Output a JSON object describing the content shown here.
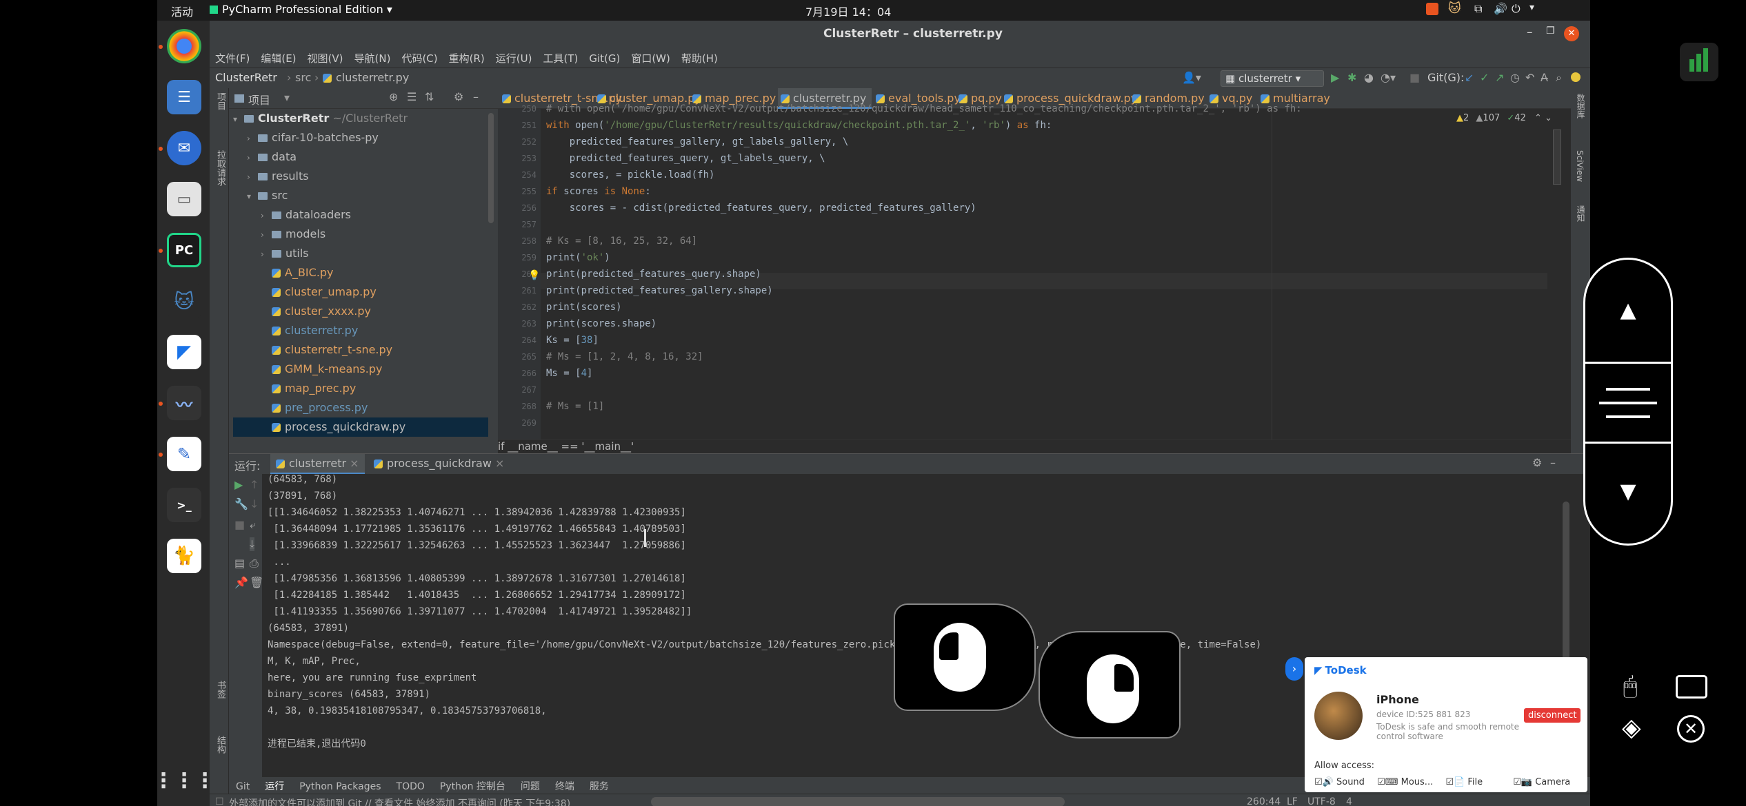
{
  "topbar": {
    "activities": "活动",
    "app": "PyCharm Professional Edition",
    "clock": "7月19日 14：04"
  },
  "title": "ClusterRetr – clusterretr.py",
  "menu": [
    "文件(F)",
    "编辑(E)",
    "视图(V)",
    "导航(N)",
    "代码(C)",
    "重构(R)",
    "运行(U)",
    "工具(T)",
    "Git(G)",
    "窗口(W)",
    "帮助(H)"
  ],
  "nav": {
    "project": "ClusterRetr",
    "folder": "src",
    "file": "clusterretr.py",
    "run_config": "clusterretr",
    "git_label": "Git(G):"
  },
  "project": {
    "header": "项目",
    "root": "ClusterRetr",
    "root_path": "~/ClusterRetr",
    "items": [
      {
        "label": "cifar-10-batches-py",
        "kind": "folder",
        "depth": 1
      },
      {
        "label": "data",
        "kind": "folder",
        "depth": 1
      },
      {
        "label": "results",
        "kind": "folder",
        "depth": 1
      },
      {
        "label": "src",
        "kind": "folder",
        "depth": 1,
        "open": true
      },
      {
        "label": "dataloaders",
        "kind": "folder",
        "depth": 2
      },
      {
        "label": "models",
        "kind": "folder",
        "depth": 2
      },
      {
        "label": "utils",
        "kind": "folder",
        "depth": 2
      },
      {
        "label": "A_BIC.py",
        "kind": "file",
        "depth": 2,
        "color": "#e0a060"
      },
      {
        "label": "cluster_umap.py",
        "kind": "file",
        "depth": 2,
        "color": "#e0a060"
      },
      {
        "label": "cluster_xxxx.py",
        "kind": "file",
        "depth": 2,
        "color": "#e0a060"
      },
      {
        "label": "clusterretr.py",
        "kind": "file",
        "depth": 2,
        "color": "#6897bb"
      },
      {
        "label": "clusterretr_t-sne.py",
        "kind": "file",
        "depth": 2,
        "color": "#e0a060"
      },
      {
        "label": "GMM_k-means.py",
        "kind": "file",
        "depth": 2,
        "color": "#e0a060"
      },
      {
        "label": "map_prec.py",
        "kind": "file",
        "depth": 2,
        "color": "#e0a060"
      },
      {
        "label": "pre_process.py",
        "kind": "file",
        "depth": 2,
        "color": "#6897bb"
      },
      {
        "label": "process_quickdraw.py",
        "kind": "file",
        "depth": 2,
        "color": "#bbbbbb",
        "selected": true
      }
    ]
  },
  "tabs": [
    {
      "label": "clusterretr_t-sne.py"
    },
    {
      "label": "cluster_umap.py"
    },
    {
      "label": "map_prec.py"
    },
    {
      "label": "clusterretr.py",
      "active": true
    },
    {
      "label": "eval_tools.py"
    },
    {
      "label": "pq.py"
    },
    {
      "label": "process_quickdraw.py"
    },
    {
      "label": "random.py"
    },
    {
      "label": "vq.py"
    },
    {
      "label": "multiarray"
    }
  ],
  "inspections": {
    "warnings": "2",
    "weak": "107",
    "typos": "42"
  },
  "code": [
    {
      "n": "250",
      "html": "<span class='cm'># with open('/home/gpu/ConvNeXt-V2/output/batchsize_120/quickdraw/head_sametr_110_co_teaching/checkpoint.pth.tar_2_', 'rb') as fh:</span>"
    },
    {
      "n": "251",
      "html": "<span class='kw'>with</span> open(<span class='st'>'/home/gpu/ClusterRetr/results/quickdraw/checkpoint.pth.tar_2_'</span>, <span class='st'>'rb'</span>) <span class='kw'>as</span> fh:"
    },
    {
      "n": "252",
      "html": "    predicted_features_gallery, gt_labels_gallery, \\"
    },
    {
      "n": "253",
      "html": "    predicted_features_query, gt_labels_query, \\"
    },
    {
      "n": "254",
      "html": "    scores, = pickle.load(fh)"
    },
    {
      "n": "255",
      "html": "<span class='kw'>if</span> scores <span class='kw'>is None</span>:"
    },
    {
      "n": "256",
      "html": "    scores = - cdist(predicted_features_query, predicted_features_gallery)"
    },
    {
      "n": "257",
      "html": ""
    },
    {
      "n": "258",
      "html": "<span class='cm'># Ks = [8, 16, 25, 32, 64]</span>"
    },
    {
      "n": "259",
      "html": "print(<span class='st'>'ok'</span>)"
    },
    {
      "n": "260",
      "html": "print(predicted_features_query.shape)"
    },
    {
      "n": "261",
      "html": "print(predicted_features_gallery.shape)"
    },
    {
      "n": "262",
      "html": "print(scores)"
    },
    {
      "n": "263",
      "html": "print(scores.shape)"
    },
    {
      "n": "264",
      "html": "Ks = [<span class='nm'>38</span>]"
    },
    {
      "n": "265",
      "html": "<span class='cm'># Ms = [1, 2, 4, 8, 16, 32]</span>"
    },
    {
      "n": "266",
      "html": "Ms = [<span class='nm'>4</span>]"
    },
    {
      "n": "267",
      "html": ""
    },
    {
      "n": "268",
      "html": "<span class='cm'># Ms = [1]</span>"
    },
    {
      "n": "269",
      "html": ""
    }
  ],
  "breadcrumb": "if __name__ == '__main__'",
  "run": {
    "label": "运行:",
    "tab1": "clusterretr",
    "tab2": "process_quickdraw"
  },
  "console": [
    "(64583, 768)",
    "(37891, 768)",
    "[[1.34646052 1.38225353 1.40746271 ... 1.38942036 1.42839788 1.42300935]",
    " [1.36448094 1.17721985 1.35361176 ... 1.49197762 1.46655843 1.40789503]",
    " [1.33966839 1.32225617 1.32546263 ... 1.45525523 1.3623447  1.27059886]",
    " ...",
    " [1.47985356 1.36813596 1.40805399 ... 1.38972678 1.31677301 1.27014618]",
    " [1.42284185 1.385442   1.4018435  ... 1.26806652 1.29417734 1.28909172]",
    " [1.41193355 1.35690766 1.39711077 ... 1.4702004  1.41749721 1.39528482]]",
    "(64583, 37891)",
    "Namespace(debug=False, extend=0, feature_file='/home/gpu/ConvNeXt-V2/output/batchsize_120/features_zero.pickle', fuse=0.2, itq=False, real=False, rerank=False, time=False)",
    "M, K, mAP, Prec,",
    "here, you are running fuse_expriment",
    "binary_scores (64583, 37891)",
    "4, 38, 0.19835418108795347, 0.18345753793706818,",
    "",
    "进程已结束,退出代码0"
  ],
  "bottom_tabs": [
    "Git",
    "运行",
    "Python Packages",
    "TODO",
    "Python 控制台",
    "问题",
    "终端",
    "服务"
  ],
  "status": {
    "message": "外部添加的文件可以添加到 Git // 查看文件  始终添加  不再询问 (昨天 下午9:38)",
    "position": "260:44",
    "eol": "LF",
    "encoding": "UTF-8",
    "indent": "4"
  },
  "todesk": {
    "brand": "ToDesk",
    "device": "iPhone",
    "device_id": "device ID:525 881 823",
    "safe": "ToDesk is safe and smooth remote control software",
    "disconnect": "disconnect",
    "allow": "Allow access:",
    "perms": [
      "Sound",
      "Mous...",
      "File",
      "Camera"
    ]
  },
  "side_labels": {
    "bookmarks": "书签",
    "structure": "结构",
    "project_side": "项目",
    "sciview": "SciView",
    "database": "数据库",
    "notifications": "通知",
    "pull": "拉取请求"
  }
}
